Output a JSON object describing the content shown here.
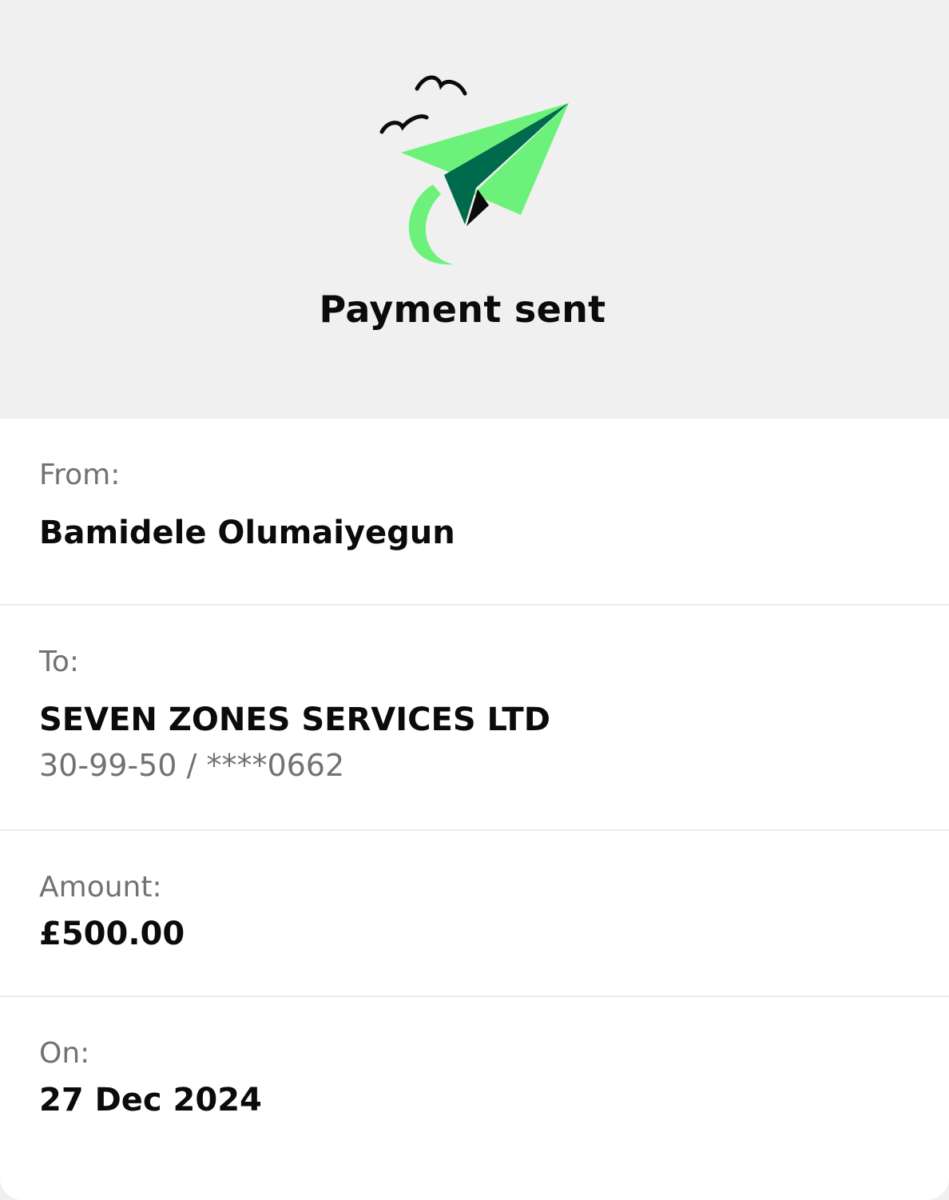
{
  "header": {
    "title": "Payment sent",
    "icon": "paper-plane-icon",
    "colors": {
      "plane_light": "#6cf27a",
      "plane_dark": "#006a4d",
      "birds": "#0b0b0b"
    }
  },
  "details": {
    "from": {
      "label": "From:",
      "value": "Bamidele Olumaiyegun"
    },
    "to": {
      "label": "To:",
      "value": "SEVEN ZONES SERVICES LTD",
      "account": "30-99-50 / ****0662"
    },
    "amount": {
      "label": "Amount:",
      "value": "£500.00"
    },
    "on": {
      "label": "On:",
      "value": "27 Dec 2024"
    }
  }
}
